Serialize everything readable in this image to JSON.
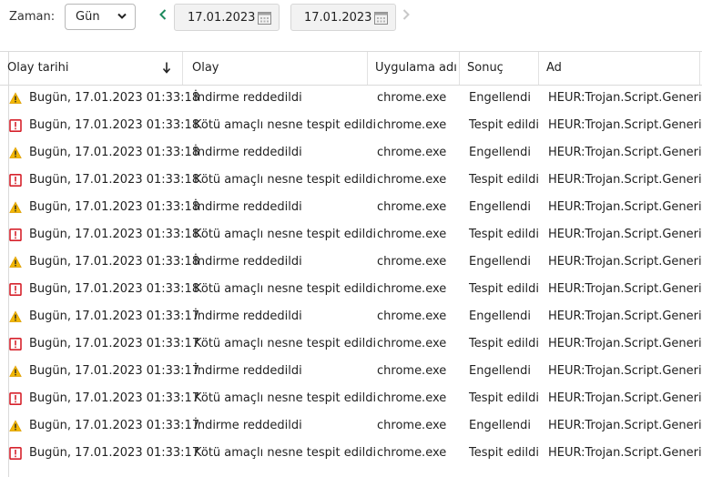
{
  "toolbar": {
    "time_label": "Zaman:",
    "period": "Gün",
    "date_from": "17.01.2023",
    "date_to": "17.01.2023"
  },
  "columns": [
    "Olay tarihi",
    "Olay",
    "Uygulama adı",
    "Sonuç",
    "Ad"
  ],
  "rows": [
    {
      "icon": "warning-icon",
      "date": "Bugün, 17.01.2023 01:33:18",
      "event": "İndirme reddedildi",
      "app": "chrome.exe",
      "result": "Engellendi",
      "name": "HEUR:Trojan.Script.Generic"
    },
    {
      "icon": "threat-icon",
      "date": "Bugün, 17.01.2023 01:33:18",
      "event": "Kötü amaçlı nesne tespit edildi",
      "app": "chrome.exe",
      "result": "Tespit edildi",
      "name": "HEUR:Trojan.Script.Generic"
    },
    {
      "icon": "warning-icon",
      "date": "Bugün, 17.01.2023 01:33:18",
      "event": "İndirme reddedildi",
      "app": "chrome.exe",
      "result": "Engellendi",
      "name": "HEUR:Trojan.Script.Generic"
    },
    {
      "icon": "threat-icon",
      "date": "Bugün, 17.01.2023 01:33:18",
      "event": "Kötü amaçlı nesne tespit edildi",
      "app": "chrome.exe",
      "result": "Tespit edildi",
      "name": "HEUR:Trojan.Script.Generic"
    },
    {
      "icon": "warning-icon",
      "date": "Bugün, 17.01.2023 01:33:18",
      "event": "İndirme reddedildi",
      "app": "chrome.exe",
      "result": "Engellendi",
      "name": "HEUR:Trojan.Script.Generic"
    },
    {
      "icon": "threat-icon",
      "date": "Bugün, 17.01.2023 01:33:18",
      "event": "Kötü amaçlı nesne tespit edildi",
      "app": "chrome.exe",
      "result": "Tespit edildi",
      "name": "HEUR:Trojan.Script.Generic"
    },
    {
      "icon": "warning-icon",
      "date": "Bugün, 17.01.2023 01:33:18",
      "event": "İndirme reddedildi",
      "app": "chrome.exe",
      "result": "Engellendi",
      "name": "HEUR:Trojan.Script.Generic"
    },
    {
      "icon": "threat-icon",
      "date": "Bugün, 17.01.2023 01:33:18",
      "event": "Kötü amaçlı nesne tespit edildi",
      "app": "chrome.exe",
      "result": "Tespit edildi",
      "name": "HEUR:Trojan.Script.Generic"
    },
    {
      "icon": "warning-icon",
      "date": "Bugün, 17.01.2023 01:33:17",
      "event": "İndirme reddedildi",
      "app": "chrome.exe",
      "result": "Engellendi",
      "name": "HEUR:Trojan.Script.Generic"
    },
    {
      "icon": "threat-icon",
      "date": "Bugün, 17.01.2023 01:33:17",
      "event": "Kötü amaçlı nesne tespit edildi",
      "app": "chrome.exe",
      "result": "Tespit edildi",
      "name": "HEUR:Trojan.Script.Generic"
    },
    {
      "icon": "warning-icon",
      "date": "Bugün, 17.01.2023 01:33:17",
      "event": "İndirme reddedildi",
      "app": "chrome.exe",
      "result": "Engellendi",
      "name": "HEUR:Trojan.Script.Generic"
    },
    {
      "icon": "threat-icon",
      "date": "Bugün, 17.01.2023 01:33:17",
      "event": "Kötü amaçlı nesne tespit edildi",
      "app": "chrome.exe",
      "result": "Tespit edildi",
      "name": "HEUR:Trojan.Script.Generic"
    },
    {
      "icon": "warning-icon",
      "date": "Bugün, 17.01.2023 01:33:17",
      "event": "İndirme reddedildi",
      "app": "chrome.exe",
      "result": "Engellendi",
      "name": "HEUR:Trojan.Script.Generic"
    },
    {
      "icon": "threat-icon",
      "date": "Bugün, 17.01.2023 01:33:17",
      "event": "Kötü amaçlı nesne tespit edildi",
      "app": "chrome.exe",
      "result": "Tespit edildi",
      "name": "HEUR:Trojan.Script.Generic"
    }
  ],
  "colors": {
    "warning": "#f2b705",
    "threat": "#d6222c",
    "nav_arrow": "#1e8a5e"
  }
}
